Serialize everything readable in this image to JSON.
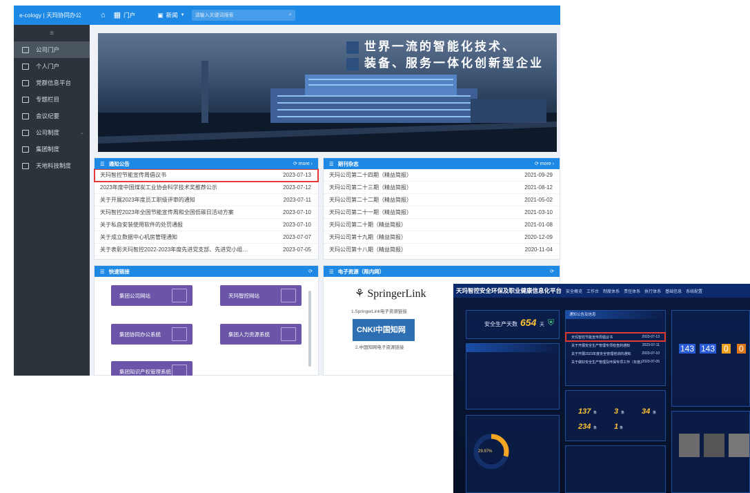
{
  "oa": {
    "brand": "e-cology | 天玛协同办公",
    "nav_portal": "门户",
    "search_scope": "新闻",
    "search_placeholder": "请输入关键词搜索",
    "sidebar": [
      {
        "label": "公司门户",
        "active": true
      },
      {
        "label": "个人门户"
      },
      {
        "label": "党群信息平台"
      },
      {
        "label": "专题栏目"
      },
      {
        "label": "会议纪要"
      },
      {
        "label": "公司制度",
        "has_children": true
      },
      {
        "label": "集团制度"
      },
      {
        "label": "天地科技制度"
      }
    ],
    "banner": {
      "line1": "世界一流的智能化技术、",
      "line2": "装备、服务一体化创新型企业"
    },
    "notices": {
      "title": "通知公告",
      "more": "more",
      "items": [
        {
          "title": "天玛智控节能宣传周倡议书",
          "date": "2023-07-13",
          "highlight": true
        },
        {
          "title": "2023年度中国煤炭工业协会科学技术奖推荐公示",
          "date": "2023-07-12"
        },
        {
          "title": "关于开展2023年度员工职级评审的通知",
          "date": "2023-07-11"
        },
        {
          "title": "天玛智控2023年全国节能宣传周和全国低碳日活动方案",
          "date": "2023-07-10"
        },
        {
          "title": "关于私自安装使用软件的处罚通报",
          "date": "2023-07-10"
        },
        {
          "title": "关于成立数据中心机房管理通知",
          "date": "2023-07-07"
        },
        {
          "title": "关于表彰天玛智控2022-2023年度先进党支部、先进党小组、优秀共产...",
          "date": "2023-07-05"
        }
      ]
    },
    "journal": {
      "title": "期刊杂志",
      "more": "more",
      "items": [
        {
          "title": "天玛公司第二十四期（精益简报）",
          "date": "2021-09-29"
        },
        {
          "title": "天玛公司第二十三期（精益简报）",
          "date": "2021-08-12"
        },
        {
          "title": "天玛公司第二十二期（精益简报）",
          "date": "2021-05-02"
        },
        {
          "title": "天玛公司第二十一期（精益简报）",
          "date": "2021-03-10"
        },
        {
          "title": "天玛公司第二十期（精益简报）",
          "date": "2021-01-08"
        },
        {
          "title": "天玛公司第十九期（精益简报）",
          "date": "2020-12-09"
        },
        {
          "title": "天玛公司第十八期（精益简报）",
          "date": "2020-11-04"
        }
      ]
    },
    "quick": {
      "title": "快速链接",
      "links": [
        "集团公司网站",
        "天玛智控网站",
        "集团协同办公系统",
        "集团人力资源系统",
        "集团知识产权管理系统"
      ]
    },
    "eresources": {
      "title": "电子资源（限内网）",
      "springer": "SpringerLink",
      "springer_caption": "1.SpringerLink电子资源链接",
      "cnki": "CNKI中国知网",
      "cnki_caption": "2.中国知网电子资源链接"
    }
  },
  "dash": {
    "title": "天玛智控安全环保及职业健康信息化平台",
    "menu": [
      "安全概览",
      "工作台",
      "制度体系",
      "责任体系",
      "执行体系",
      "基础信息",
      "系统配置"
    ],
    "safe_days_label": "安全生产天数",
    "safe_days": "654",
    "safe_days_unit": "天",
    "notice_panel": "通知公告及信息",
    "notices": [
      {
        "title": "天玛智控节能宣传周倡议书",
        "date": "2023-07-13",
        "highlight": true
      },
      {
        "title": "关于开展安全生产管理专项检查的通知",
        "date": "2023-07-11"
      },
      {
        "title": "关于开展2023年度安全管理培训的通知",
        "date": "2023-07-10"
      },
      {
        "title": "关于做好安全生产管理及环保专项工作（年度总结）的通知",
        "date": "2023-07-05"
      }
    ],
    "stats": [
      {
        "value": "137",
        "unit": "条"
      },
      {
        "value": "3",
        "unit": "条"
      },
      {
        "value": "34",
        "unit": "条"
      },
      {
        "value": "234",
        "unit": "条"
      },
      {
        "value": "1",
        "unit": "条"
      }
    ],
    "ring_percent": "29.97%",
    "right_values": [
      "143",
      "143",
      "0",
      "0"
    ]
  },
  "colors": {
    "oa_primary": "#1e88e5",
    "sidebar": "#2c333b",
    "quick_button": "#6a55a8",
    "highlight": "#e53935",
    "dash_bg": "#061026",
    "dash_value": "#ffc233"
  }
}
